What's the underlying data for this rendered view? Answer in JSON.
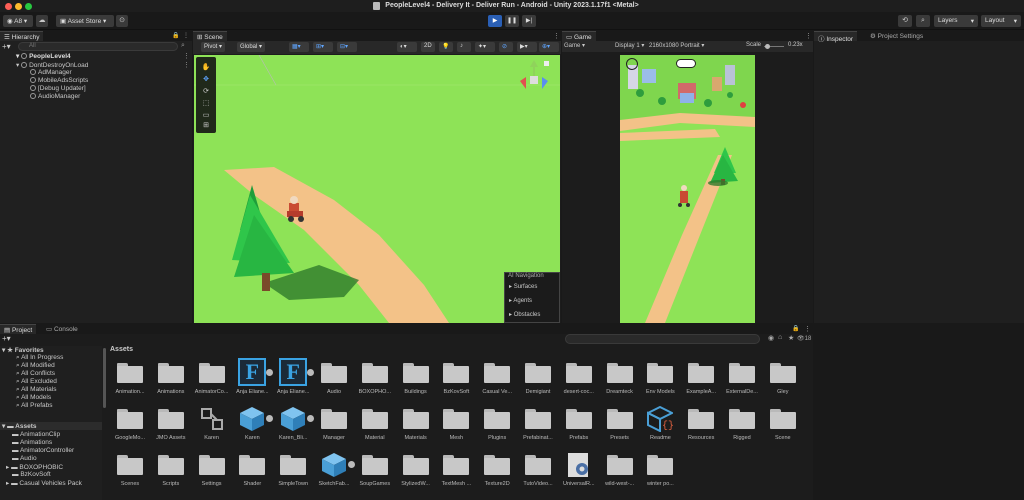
{
  "window": {
    "title": "PeopleLevel4 - Delivery It - Deliver Run - Android - Unity 2023.1.17f1 <Metal>"
  },
  "toolbar": {
    "account": "A8",
    "asset_store": "Asset Store",
    "layers": "Layers",
    "layout": "Layout"
  },
  "hierarchy": {
    "tab": "Hierarchy",
    "search_placeholder": "All",
    "scene_name": "PeopleLevel4",
    "dont_destroy": "DontDestroyOnLoad",
    "items": [
      "AdManager",
      "MobileAdsScripts",
      "[Debug Updater]",
      "AudioManager"
    ]
  },
  "scene": {
    "tab": "Scene",
    "pivot": "Pivot",
    "global": "Global",
    "mode_2d": "2D",
    "ai_nav": {
      "title": "AI Navigation",
      "items": [
        "Surfaces",
        "Agents",
        "Obstacles"
      ]
    }
  },
  "game": {
    "tab": "Game",
    "mode": "Game",
    "display": "Display 1",
    "resolution": "2160x1080 Portrait",
    "scale_label": "Scale",
    "scale_value": "0.23x"
  },
  "inspector": {
    "tab": "Inspector",
    "settings_tab": "Project Settings"
  },
  "project": {
    "tab": "Project",
    "console_tab": "Console",
    "favorites_label": "Favorites",
    "favorites": [
      "All In Progress",
      "All Modified",
      "All Conflicts",
      "All Excluded",
      "All Materials",
      "All Models",
      "All Prefabs"
    ],
    "assets_label": "Assets",
    "tree": [
      "AnimationClip",
      "Animations",
      "AnimatorController",
      "Audio",
      "BOXOPHOBIC",
      "BzKovSoft",
      "Casual Vehicles Pack"
    ],
    "breadcrumb": "Assets",
    "count": "18",
    "grid": [
      [
        "Animation...",
        "Animations",
        "AnimatorCo...",
        "Anja Eliane...",
        "Anja Eliane...",
        "Audio",
        "BOXOPHO...",
        "Buildings",
        "BzKovSoft",
        "Casual Ve...",
        "Demigiant",
        "desert-coc...",
        "Dreamteck",
        "Env Models",
        "ExampleA...",
        "ExternalDe...",
        "Gley"
      ],
      [
        "GoogleMo...",
        "JMO Assets",
        "Karen",
        "Karen",
        "Karen_Bli...",
        "Manager",
        "Material",
        "Materials",
        "Mesh",
        "Plugins",
        "Prefabinat...",
        "Prefabs",
        "Presets",
        "Readme",
        "Resources",
        "Rigged",
        "Scene"
      ],
      [
        "Scenes",
        "Scripts",
        "Settings",
        "Shader",
        "SimpleTown",
        "SketchFab...",
        "SoupGames",
        "StylizedW...",
        "TextMesh ...",
        "Texture2D",
        "TutoVideo...",
        "UniversalR...",
        "wild-west-...",
        "winter po..."
      ]
    ]
  },
  "colors": {
    "ground": "#8ee357",
    "path": "#f3c288",
    "tree": "#2fc64a",
    "accent": "#3aa3e3",
    "play_active": "#2a5fb5"
  }
}
